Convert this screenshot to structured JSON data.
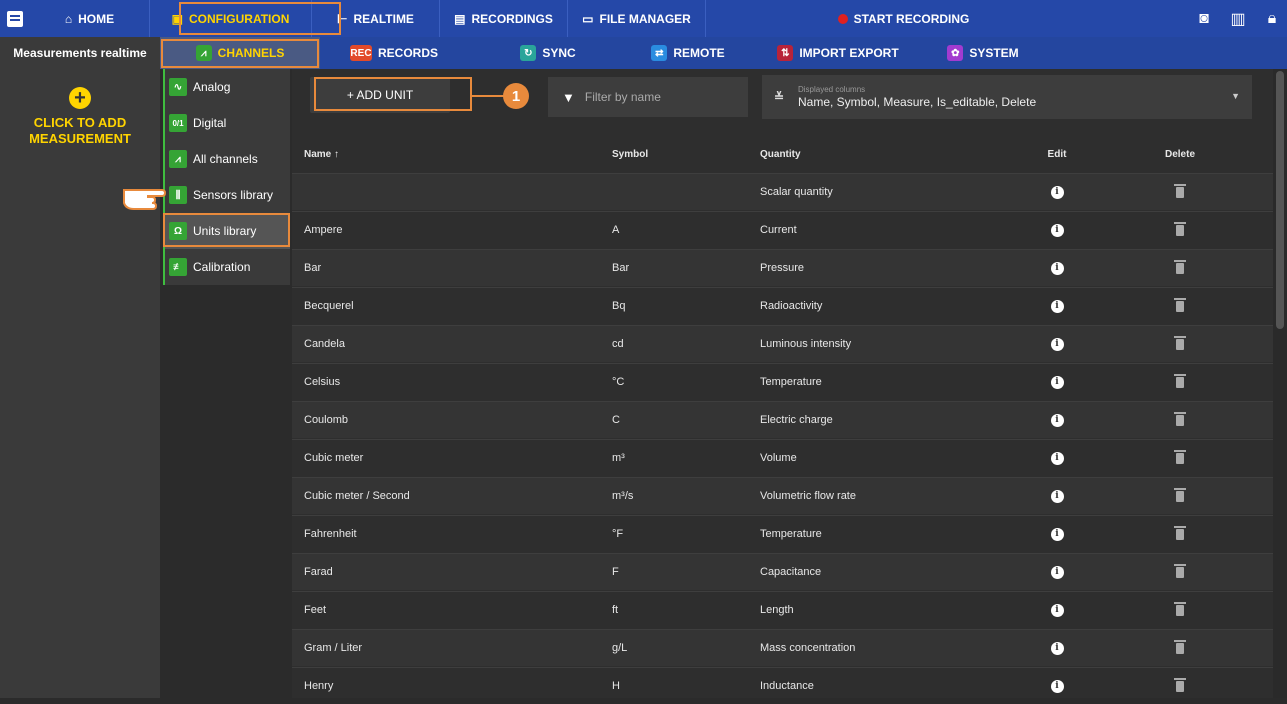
{
  "topbar": {
    "home": "HOME",
    "configuration": "CONFIGURATION",
    "realtime": "REALTIME",
    "recordings": "RECORDINGS",
    "file_manager": "FILE MANAGER",
    "start_recording": "START RECORDING"
  },
  "subbar": {
    "title": "Measurements realtime",
    "channels": "CHANNELS",
    "records": "RECORDS",
    "sync": "SYNC",
    "remote": "REMOTE",
    "import_export": "IMPORT EXPORT",
    "system": "SYSTEM"
  },
  "left": {
    "add_line1": "CLICK TO ADD",
    "add_line2": "MEASUREMENT"
  },
  "sidenav": [
    {
      "label": "Analog",
      "icon": "analog-icon",
      "glyph": "∿"
    },
    {
      "label": "Digital",
      "icon": "digital-icon",
      "glyph": "0/1"
    },
    {
      "label": "All channels",
      "icon": "all-channels-icon",
      "glyph": "⩘"
    },
    {
      "label": "Sensors library",
      "icon": "sensors-icon",
      "glyph": "⫼"
    },
    {
      "label": "Units library",
      "icon": "units-icon",
      "glyph": "Ω"
    },
    {
      "label": "Calibration",
      "icon": "calibration-icon",
      "glyph": "≢"
    }
  ],
  "toolbar": {
    "add_unit": "+ ADD UNIT",
    "badge": "1",
    "filter_placeholder": "Filter by name",
    "columns_label": "Displayed columns",
    "columns_value": "Name, Symbol, Measure, Is_editable, Delete"
  },
  "table": {
    "headers": {
      "name": "Name ↑",
      "symbol": "Symbol",
      "quantity": "Quantity",
      "edit": "Edit",
      "delete": "Delete"
    },
    "rows": [
      {
        "name": "",
        "symbol": "",
        "quantity": "Scalar quantity"
      },
      {
        "name": "Ampere",
        "symbol": "A",
        "quantity": "Current"
      },
      {
        "name": "Bar",
        "symbol": "Bar",
        "quantity": "Pressure"
      },
      {
        "name": "Becquerel",
        "symbol": "Bq",
        "quantity": "Radioactivity"
      },
      {
        "name": "Candela",
        "symbol": "cd",
        "quantity": "Luminous intensity"
      },
      {
        "name": "Celsius",
        "symbol": "°C",
        "quantity": "Temperature"
      },
      {
        "name": "Coulomb",
        "symbol": "C",
        "quantity": "Electric charge"
      },
      {
        "name": "Cubic meter",
        "symbol": "m³",
        "quantity": "Volume"
      },
      {
        "name": "Cubic meter / Second",
        "symbol": "m³/s",
        "quantity": "Volumetric flow rate"
      },
      {
        "name": "Fahrenheit",
        "symbol": "°F",
        "quantity": "Temperature"
      },
      {
        "name": "Farad",
        "symbol": "F",
        "quantity": "Capacitance"
      },
      {
        "name": "Feet",
        "symbol": "ft",
        "quantity": "Length"
      },
      {
        "name": "Gram / Liter",
        "symbol": "g/L",
        "quantity": "Mass concentration"
      },
      {
        "name": "Henry",
        "symbol": "H",
        "quantity": "Inductance"
      }
    ]
  },
  "colors": {
    "topbar": "#2548a8",
    "active_text": "#ffd400",
    "highlight": "#e88a3c",
    "green": "#35a435"
  }
}
